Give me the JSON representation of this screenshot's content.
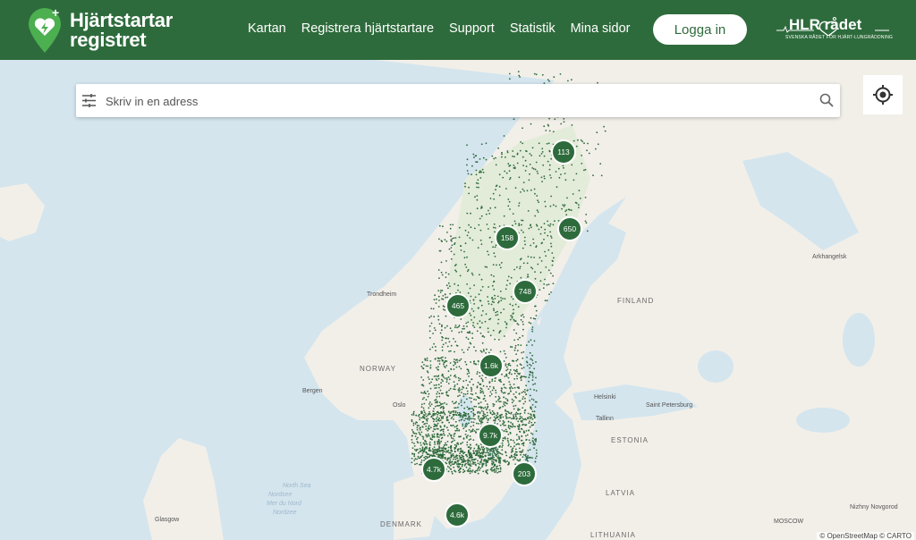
{
  "header": {
    "logo": {
      "line1": "Hjärtstartar",
      "line2": "registret",
      "icon": "heart-aed-pin-icon"
    },
    "nav": [
      "Kartan",
      "Registrera hjärtstartare",
      "Support",
      "Statistik",
      "Mina sidor"
    ],
    "login_label": "Logga in",
    "partner_logo": {
      "text": "HLR rådet",
      "subtitle": "SVENSKA RÅDET FÖR HJÄRT-LUNGRÄDDNING"
    }
  },
  "search": {
    "placeholder": "Skriv in en adress",
    "value": ""
  },
  "clusters": [
    {
      "label": "113"
    },
    {
      "label": "158"
    },
    {
      "label": "650"
    },
    {
      "label": "748"
    },
    {
      "label": "465"
    },
    {
      "label": "1.6k"
    },
    {
      "label": "9.7k"
    },
    {
      "label": "4.7k"
    },
    {
      "label": "203"
    },
    {
      "label": "4.6k"
    }
  ],
  "map_labels": {
    "countries": [
      "NORWAY",
      "FINLAND",
      "ESTONIA",
      "LATVIA",
      "LITHUANIA",
      "DENMARK"
    ],
    "cities": [
      "Trondheim",
      "Bergen",
      "Oslo",
      "Helsinki",
      "Tallinn",
      "Saint Petersburg",
      "Arkhangelsk",
      "Glasgow",
      "Nizhny Novgorod",
      "MOSCOW"
    ],
    "seas": [
      "North Sea",
      "Nordsee",
      "Mer du Nord",
      "Nordzee"
    ],
    "attribution": "© OpenStreetMap © CARTO"
  },
  "colors": {
    "brand": "#2e6b3c",
    "water": "#d4e5ee",
    "land": "#f2efe9"
  }
}
